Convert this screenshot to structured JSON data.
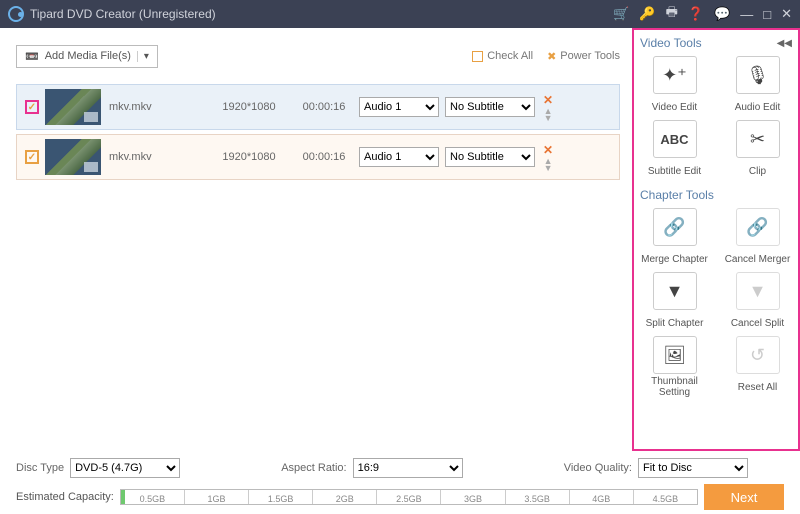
{
  "titlebar": {
    "title": "Tipard DVD Creator (Unregistered)"
  },
  "topbar": {
    "add_media": "Add Media File(s)",
    "check_all": "Check All",
    "power_tools": "Power Tools"
  },
  "rows": [
    {
      "filename": "mkv.mkv",
      "resolution": "1920*1080",
      "duration": "00:00:16",
      "audio": "Audio 1",
      "subtitle": "No Subtitle",
      "checked": true,
      "style": "sel"
    },
    {
      "filename": "mkv.mkv",
      "resolution": "1920*1080",
      "duration": "00:00:16",
      "audio": "Audio 1",
      "subtitle": "No Subtitle",
      "checked": true,
      "style": "ora"
    }
  ],
  "panel": {
    "video_title": "Video Tools",
    "chapter_title": "Chapter Tools",
    "video_tools": {
      "edit": "Video Edit",
      "audio": "Audio Edit",
      "subtitle": "Subtitle Edit",
      "clip": "Clip"
    },
    "chapter_tools": {
      "merge": "Merge Chapter",
      "cancel_merge": "Cancel Merger",
      "split": "Split Chapter",
      "cancel_split": "Cancel Split",
      "thumb": "Thumbnail Setting",
      "reset": "Reset All"
    }
  },
  "footer": {
    "disc_type_label": "Disc Type",
    "disc_type": "DVD-5 (4.7G)",
    "aspect_label": "Aspect Ratio:",
    "aspect": "16:9",
    "quality_label": "Video Quality:",
    "quality": "Fit to Disc",
    "next": "Next",
    "capacity_label": "Estimated Capacity:",
    "ticks": [
      "0.5GB",
      "1GB",
      "1.5GB",
      "2GB",
      "2.5GB",
      "3GB",
      "3.5GB",
      "4GB",
      "4.5GB"
    ]
  },
  "select_options": {
    "audio": [
      "Audio 1"
    ],
    "subtitle": [
      "No Subtitle"
    ]
  }
}
